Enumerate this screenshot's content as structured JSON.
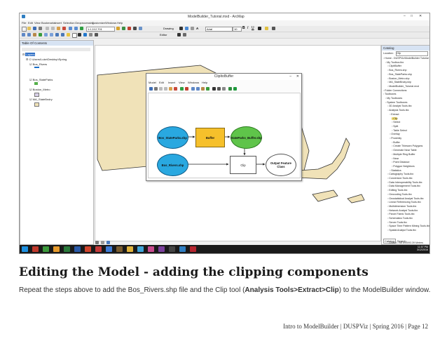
{
  "window": {
    "title": "ModelBuilder_Tutorial.mxd - ArcMap"
  },
  "menu": [
    "File",
    "Edit",
    "View",
    "Bookmarks",
    "Insert",
    "Selection",
    "Geoprocessing",
    "Customize",
    "Windows",
    "Help"
  ],
  "toolbar": {
    "scale": "1:1,112,701",
    "drawing_label": "Drawing",
    "editor_label": "Editor",
    "font": "Arial",
    "font_size": "10"
  },
  "toc": {
    "title": "Table Of Contents",
    "layers_label": "Layers",
    "path": "C:\\Users\\Luke\\Desktop\\Spring",
    "layers": [
      "Bos_Rivers",
      "Bos_StateParks",
      "Boston_Metro",
      "MA_StateBndry"
    ]
  },
  "catalog": {
    "title": "Catalog",
    "location_label": "Location:",
    "location_value": "Clip",
    "items": [
      "Home - DUSPViz\\ModelBuilder Tutorial",
      "My Toolbox.tbx",
      "ClipItBuffer",
      "Bos_Rivers.shp",
      "Bos_StateParks.shp",
      "Boston_Metro.shp",
      "MA_StateBndry.shp",
      "ModelBuilder_Tutorial.mxd",
      "Folder Connections",
      "Toolboxes",
      "My Toolboxes",
      "System Toolboxes",
      "3D Analyst Tools.tbx",
      "Analysis Tools.tbx",
      "Extract",
      "Clip",
      "Select",
      "Split",
      "Table Select",
      "Overlay",
      "Proximity",
      "Buffer",
      "Create Thiessen Polygons",
      "Generate Near Table",
      "Multiple Ring Buffer",
      "Near",
      "Point Distance",
      "Polygon Neighbors",
      "Statistics",
      "Cartography Tools.tbx",
      "Conversion Tools.tbx",
      "Data Interoperability Tools.tbx",
      "Data Management Tools.tbx",
      "Editing Tools.tbx",
      "Geocoding Tools.tbx",
      "Geostatistical Analyst Tools.tbx",
      "Linear Referencing Tools.tbx",
      "Multidimension Tools.tbx",
      "Network Analyst Tools.tbx",
      "Parcel Fabric Tools.tbx",
      "Schematics Tools.tbx",
      "Server Tools.tbx",
      "Space Time Pattern Mining Tools.tbx",
      "Spatial Analyst Tools.tbx"
    ],
    "tabs": [
      "Catalog",
      "Search"
    ]
  },
  "status": {
    "coords": "226021.788  890093.39 Meters"
  },
  "taskbar": {
    "time": "11:57 PM",
    "date": "3/12/2016"
  },
  "modelbuilder": {
    "title": "ClipItoBuffer",
    "menu": [
      "Model",
      "Edit",
      "Insert",
      "View",
      "Windows",
      "Help"
    ],
    "nodes": {
      "input1": "Bos_StateParks.shp",
      "tool1": "Buffer",
      "output1": "StateParks_Buffer.shp",
      "input2": "Bos_Rivers.shp",
      "tool2": "Clip",
      "output2": "Output Feature Class"
    }
  },
  "heading": "Editing the Model - adding the clipping components",
  "body": {
    "pre": "Repeat the steps above to add the Bos_Rivers.shp file and the Clip tool (",
    "bold": "Analysis Tools>Extract>Clip",
    "post": ") to the ModelBuilder window."
  },
  "footer": "Intro to ModelBuilder | DUSPViz | Spring 2016 | Page 12",
  "colors": {
    "input": "#29a8e0",
    "tool": "#f6c02b",
    "output": "#5fc44a",
    "map_land": "#f0e2b8",
    "taskbar": "#1a1a1a"
  }
}
